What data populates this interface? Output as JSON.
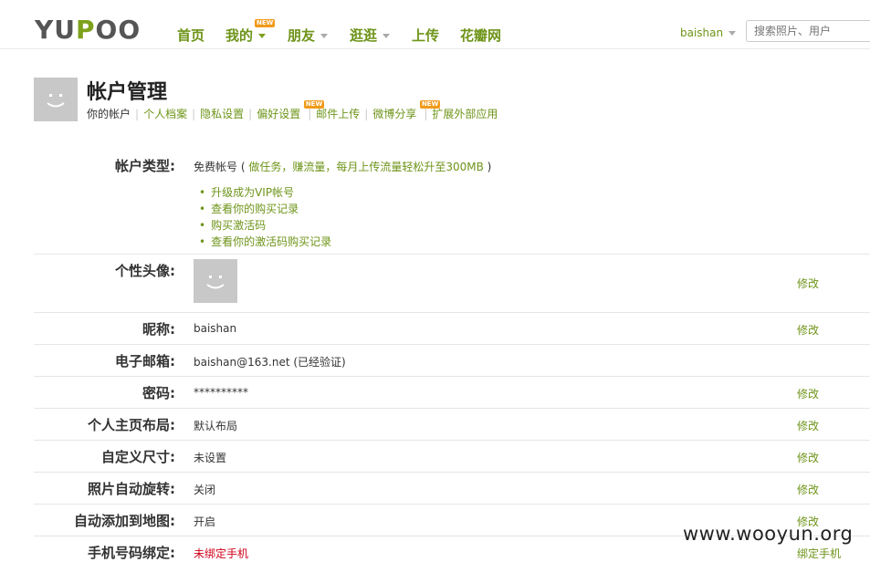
{
  "logo": {
    "text_a": "YU",
    "text_b": "P",
    "text_c": "OO"
  },
  "nav": {
    "items": [
      {
        "label": "首页"
      },
      {
        "label": "我的",
        "badge": "NEW"
      },
      {
        "label": "朋友"
      },
      {
        "label": "逛逛"
      },
      {
        "label": "上传"
      },
      {
        "label": "花瓣网"
      }
    ]
  },
  "user": {
    "name": "baishan"
  },
  "search": {
    "placeholder": "搜索照片、用户"
  },
  "header": {
    "title": "帐户管理",
    "subnav": [
      {
        "label": "你的帐户"
      },
      {
        "label": "个人档案"
      },
      {
        "label": "隐私设置"
      },
      {
        "label": "偏好设置",
        "badge": "NEW"
      },
      {
        "label": "邮件上传"
      },
      {
        "label": "微博分享",
        "badge": "NEW"
      },
      {
        "label": "扩展外部应用"
      }
    ]
  },
  "account": {
    "type_label": "帐户类型:",
    "type_value": "免费帐号",
    "type_paren_open": " ( ",
    "type_hint": "做任务，赚流量，每月上传流量轻松升至300MB",
    "type_paren_close": " )",
    "links": [
      "升级成为VIP帐号",
      "查看你的购买记录",
      "购买激活码",
      "查看你的激活码购买记录"
    ]
  },
  "rows": [
    {
      "label": "个性头像:",
      "value": "",
      "action": "修改"
    },
    {
      "label": "昵称:",
      "value": "baishan",
      "action": "修改"
    },
    {
      "label": "电子邮箱:",
      "value": "baishan@163.net (已经验证)",
      "action": ""
    },
    {
      "label": "密码:",
      "value": "**********",
      "action": "修改"
    },
    {
      "label": "个人主页布局:",
      "value": "默认布局",
      "action": "修改"
    },
    {
      "label": "自定义尺寸:",
      "value": "未设置",
      "action": "修改"
    },
    {
      "label": "照片自动旋转:",
      "value": "关闭",
      "action": "修改"
    },
    {
      "label": "自动添加到地图:",
      "value": "开启",
      "action": "修改"
    },
    {
      "label": "手机号码绑定:",
      "value": "未绑定手机",
      "action": "绑定手机"
    }
  ],
  "watermark": "www.wooyun.org",
  "colors": {
    "accent": "#6e9419",
    "badge": "#f19a1a",
    "warning": "#d0021b"
  }
}
